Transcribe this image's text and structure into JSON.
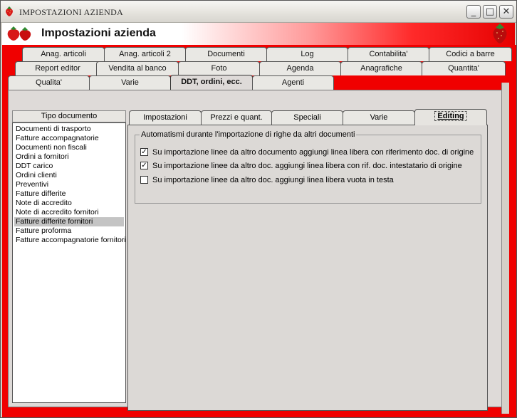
{
  "window": {
    "title": "IMPOSTAZIONI AZIENDA",
    "minimize": "_",
    "maximize": "□",
    "close": "✕"
  },
  "header": {
    "title": "Impostazioni azienda",
    "accent": "#e60000"
  },
  "outer_tabs": {
    "row1": [
      "Anag. articoli",
      "Anag. articoli 2",
      "Documenti",
      "Log",
      "Contabilita'",
      "Codici a barre"
    ],
    "row2": [
      "Report editor",
      "Vendita al banco",
      "Foto",
      "Agenda",
      "Anagrafiche",
      "Quantita'"
    ],
    "row3": [
      "Qualita'",
      "Varie",
      "DDT, ordini, ecc.",
      "Agenti"
    ],
    "active": "DDT, ordini, ecc."
  },
  "list": {
    "header": "Tipo documento",
    "items": [
      "Documenti di trasporto",
      "Fatture accompagnatorie",
      "Documenti non fiscali",
      "Ordini a fornitori",
      "DDT carico",
      "Ordini clienti",
      "Preventivi",
      "Fatture differite",
      "Note di accredito",
      "Note di accredito fornitori",
      "Fatture differite fornitori",
      "Fatture proforma",
      "Fatture accompagnatorie fornitori"
    ],
    "selected": "Fatture differite fornitori"
  },
  "inner_tabs": {
    "labels": [
      "Impostazioni",
      "Prezzi e quant.",
      "Speciali",
      "Varie",
      "Editing"
    ],
    "active": "Editing"
  },
  "group": {
    "title": "Automatismi durante l'importazione di righe da altri documenti",
    "options": [
      {
        "label": "Su importazione linee da altro documento aggiungi linea libera con riferimento doc. di origine",
        "checked": true
      },
      {
        "label": "Su importazione linee da altro doc. aggiungi linea libera con rif. doc. intestatario di origine",
        "checked": true
      },
      {
        "label": "Su importazione linee da altro doc. aggiungi linea libera vuota in testa",
        "checked": false
      }
    ]
  }
}
